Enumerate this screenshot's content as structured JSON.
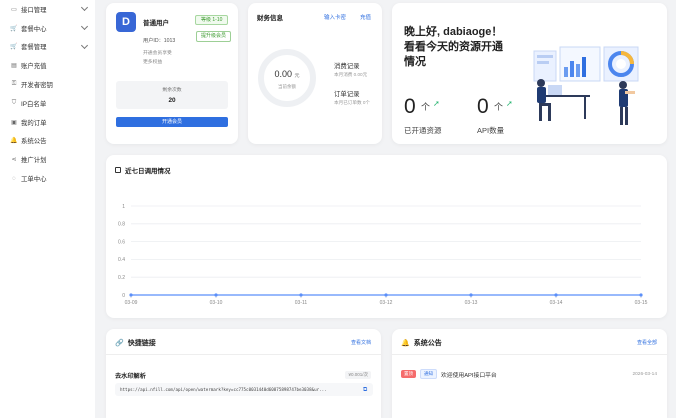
{
  "sidebar": {
    "items": [
      {
        "label": "接口管理",
        "icon": "api-icon",
        "expandable": true
      },
      {
        "label": "套餐中心",
        "icon": "cart-icon",
        "expandable": true
      },
      {
        "label": "套餐管理",
        "icon": "cart-icon",
        "expandable": true
      },
      {
        "label": "账户充值",
        "icon": "wallet-icon",
        "expandable": false
      },
      {
        "label": "开发者密钥",
        "icon": "key-icon",
        "expandable": false
      },
      {
        "label": "IP白名单",
        "icon": "shield-icon",
        "expandable": false
      },
      {
        "label": "我的订单",
        "icon": "order-icon",
        "expandable": false
      },
      {
        "label": "系统公告",
        "icon": "bell-icon",
        "expandable": false
      },
      {
        "label": "推广计划",
        "icon": "share-icon",
        "expandable": false
      },
      {
        "label": "工单中心",
        "icon": "chat-icon",
        "expandable": false
      }
    ]
  },
  "user": {
    "avatar_letter": "D",
    "name": "普通用户",
    "id_label": "用户ID：1013",
    "level_tag": "等级 1-10",
    "upgrade_button": "提升级会员",
    "sub1": "开通会员享受",
    "sub2": "更多权益",
    "remain_label": "剩余次数",
    "remain_value": "20",
    "open_button": "开通会员"
  },
  "finance": {
    "title": "财务信息",
    "link_card": "输入卡密",
    "link_recharge": "充值",
    "balance": "0.00",
    "balance_unit": "元",
    "balance_label": "当前余额",
    "consume_title": "消费记录",
    "consume_sub": "本月消费 0.00元",
    "order_title": "订单记录",
    "order_sub": "本月已订单数 0个"
  },
  "welcome": {
    "greeting": "晚上好, dabiaoge！看看今天的资源开通情况",
    "stat1_value": "0",
    "stat1_unit": "个",
    "stat1_label": "已开通资源",
    "stat2_value": "0",
    "stat2_unit": "个",
    "stat2_label": "API数量",
    "colors": {
      "arrow": "#2bb673"
    }
  },
  "chart": {
    "title": "近七日调用情况"
  },
  "chart_data": {
    "type": "line",
    "categories": [
      "03-09",
      "03-10",
      "03-11",
      "03-12",
      "03-13",
      "03-14",
      "03-15"
    ],
    "series": [
      {
        "values": [
          0,
          0,
          0,
          0,
          0,
          0,
          0
        ]
      }
    ],
    "ylim": [
      0,
      1
    ],
    "yticks": [
      "0",
      "0.2",
      "0.4",
      "0.6",
      "0.8",
      "1"
    ],
    "grid": true,
    "color": "#5b8ff9"
  },
  "links": {
    "title": "快捷链接",
    "more": "查看文档",
    "item_name": "去水印解析",
    "item_price": "¥0.001/次",
    "item_url": "https://api.nfill.com/api/open/watermark?key=cc775c0031440d60875898747be3038&ur..."
  },
  "notices": {
    "title": "系统公告",
    "more": "查看全部",
    "items": [
      {
        "tag1": "置顶",
        "tag2": "通知",
        "text": "欢迎使用API接口平台",
        "date": "2026-03-14"
      }
    ]
  }
}
